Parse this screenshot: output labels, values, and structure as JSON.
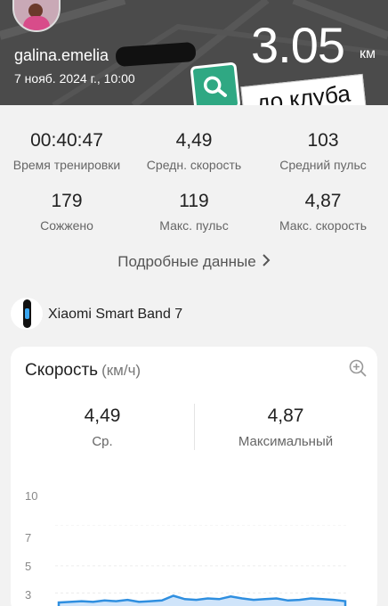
{
  "header": {
    "username": "galina.emelia",
    "date": "7 нояб. 2024 г., 10:00",
    "distance": "3.05",
    "distance_unit": "км",
    "sticker_text": "до клуба",
    "background_color": "#4b4b4b",
    "sticker_color": "#2fa883"
  },
  "stats": [
    {
      "value": "00:40:47",
      "label": "Время тренировки"
    },
    {
      "value": "4,49",
      "label": "Средн. скорость"
    },
    {
      "value": "103",
      "label": "Средний пульс"
    },
    {
      "value": "179",
      "label": "Сожжено"
    },
    {
      "value": "119",
      "label": "Макс. пульс"
    },
    {
      "value": "4,87",
      "label": "Макс. скорость"
    }
  ],
  "details_link": "Подробные данные",
  "device": {
    "name": "Xiaomi Smart Band 7"
  },
  "speed_card": {
    "title": "Скорость",
    "unit": "(км/ч)",
    "avg_value": "4,49",
    "avg_label": "Ср.",
    "max_value": "4,87",
    "max_label": "Максимальный",
    "y_ticks": [
      "10",
      "7",
      "5",
      "3"
    ],
    "accent_color": "#2f8fe0"
  },
  "chart_data": {
    "type": "area",
    "ylim": [
      3,
      10
    ],
    "y_ticks": [
      10,
      7,
      5,
      3
    ],
    "values": [
      4.3,
      4.35,
      4.4,
      4.35,
      4.45,
      4.4,
      4.5,
      4.35,
      4.4,
      4.45,
      4.8,
      4.55,
      4.5,
      4.6,
      4.55,
      4.75,
      4.6,
      4.5,
      4.55,
      4.6,
      4.45,
      4.5,
      4.6,
      4.55,
      4.5,
      4.4
    ]
  }
}
